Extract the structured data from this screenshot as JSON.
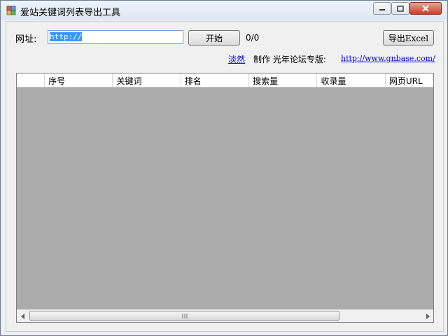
{
  "window": {
    "title": "爱站关键词列表导出工具"
  },
  "toolbar": {
    "url_label": "网址:",
    "url_value": "http://",
    "start_label": "开始",
    "progress": "0/0",
    "export_label": "导出Excel"
  },
  "credit": {
    "author": "淡然",
    "text": "制作 光年论坛专版:",
    "site": "http://www.gnbase.com/"
  },
  "grid": {
    "columns": [
      "",
      "序号",
      "关键词",
      "排名",
      "搜索量",
      "收录量",
      "网页URL"
    ]
  },
  "icons": {
    "minimize": "minimize-icon",
    "maximize": "maximize-icon",
    "close": "close-icon",
    "scroll_left": "chevron-left-icon",
    "scroll_right": "chevron-right-icon"
  },
  "colors": {
    "grid_bg": "#ababab",
    "link": "#0000ee",
    "selection": "#3399ff"
  }
}
